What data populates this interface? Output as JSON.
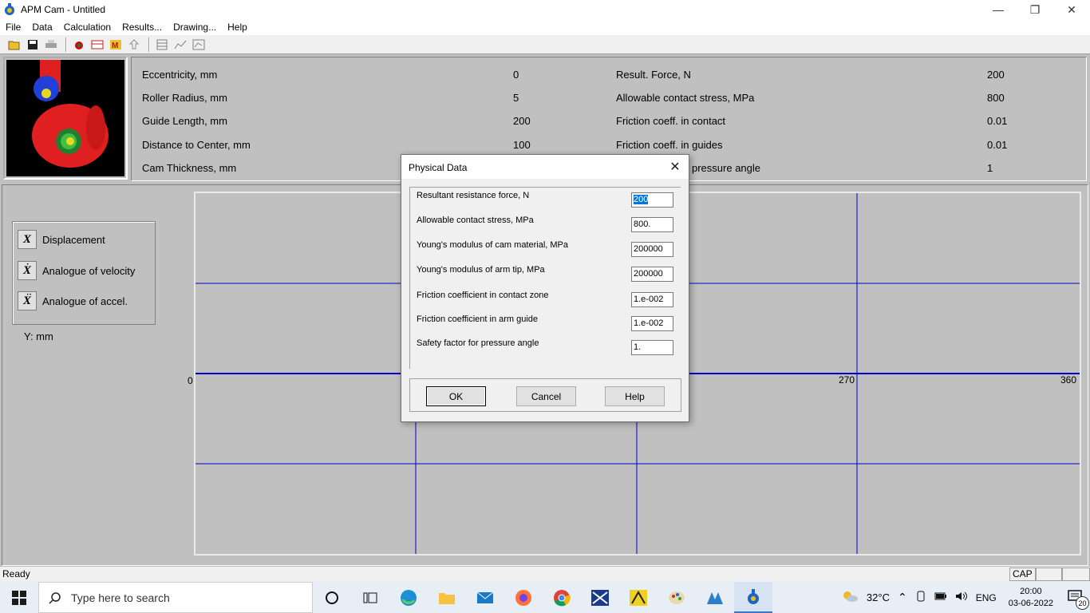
{
  "window": {
    "title": "APM Cam - Untitled",
    "minimize": "—",
    "maximize": "❐",
    "close": "✕"
  },
  "menu": [
    "File",
    "Data",
    "Calculation",
    "Results...",
    "Drawing...",
    "Help"
  ],
  "params": {
    "left": [
      {
        "label": "Eccentricity, mm",
        "value": "0"
      },
      {
        "label": "Roller Radius, mm",
        "value": "5"
      },
      {
        "label": "Guide Length, mm",
        "value": "200"
      },
      {
        "label": "Distance to Center, mm",
        "value": "100"
      },
      {
        "label": "Cam Thickness, mm",
        "value": ""
      }
    ],
    "right": [
      {
        "label": "Result. Force, N",
        "value": "200"
      },
      {
        "label": "Allowable contact stress, MPa",
        "value": "800"
      },
      {
        "label": "Friction coeff. in contact",
        "value": "0.01"
      },
      {
        "label": "Friction coeff. in guides",
        "value": "0.01"
      },
      {
        "label": "pressure angle",
        "value": "1"
      }
    ]
  },
  "legend": {
    "items": [
      {
        "symbol": "X",
        "label": "Displacement"
      },
      {
        "symbol": "X",
        "label": "Analogue of velocity"
      },
      {
        "symbol": "X",
        "label": "Analogue of accel."
      }
    ],
    "y_unit": "Y: mm"
  },
  "plot": {
    "x_labels": {
      "left": "0",
      "x270": "270",
      "x360": "360"
    },
    "grid_color": "#0000cc"
  },
  "dialog": {
    "title": "Physical Data",
    "fields": [
      {
        "label": "Resultant resistance force, N",
        "value": "200"
      },
      {
        "label": "Allowable contact stress, MPa",
        "value": "800."
      },
      {
        "label": "Young's modulus of cam material, MPa",
        "value": "200000"
      },
      {
        "label": "Young's modulus of arm tip, MPa",
        "value": "200000"
      },
      {
        "label": "Friction coefficient in contact zone",
        "value": "1.e-002"
      },
      {
        "label": "Friction coefficient in arm guide",
        "value": "1.e-002"
      },
      {
        "label": "Safety factor for pressure angle",
        "value": "1."
      }
    ],
    "buttons": {
      "ok": "OK",
      "cancel": "Cancel",
      "help": "Help"
    }
  },
  "status": {
    "text": "Ready",
    "cap": "CAP"
  },
  "taskbar": {
    "search_placeholder": "Type here to search",
    "weather": "32°C",
    "language": "ENG",
    "time": "20:00",
    "date": "03-06-2022",
    "notifications": "20"
  }
}
